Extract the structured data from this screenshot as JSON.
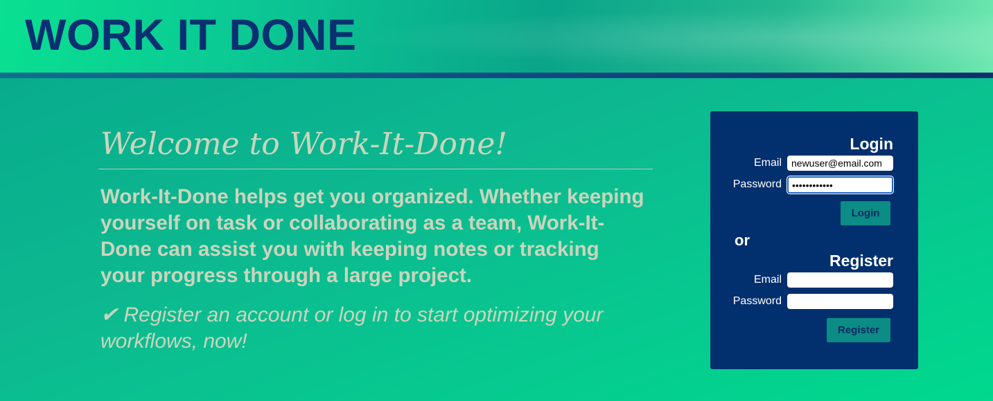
{
  "header": {
    "brand": "WORK IT DONE"
  },
  "intro": {
    "title": "Welcome to Work-It-Done!",
    "description": "Work-It-Done helps get you organized. Whether keeping yourself on task or collaborating as a team, Work-It-Done can assist you with keeping notes or tracking your progress through a large project.",
    "cta": "✔ Register an account or log in to start optimizing your workflows, now!"
  },
  "login": {
    "title": "Login",
    "email_label": "Email",
    "email_value": "newuser@email.com",
    "password_label": "Password",
    "password_value": "password1234",
    "button": "Login"
  },
  "separator": "or",
  "register": {
    "title": "Register",
    "email_label": "Email",
    "email_value": "",
    "password_label": "Password",
    "password_value": "",
    "button": "Register"
  },
  "colors": {
    "brand_text": "#0b3072",
    "panel_bg": "#022f6e",
    "button_bg": "#0b8c84",
    "body_text": "#cbd5bd",
    "accent_green": "#00d98e"
  }
}
